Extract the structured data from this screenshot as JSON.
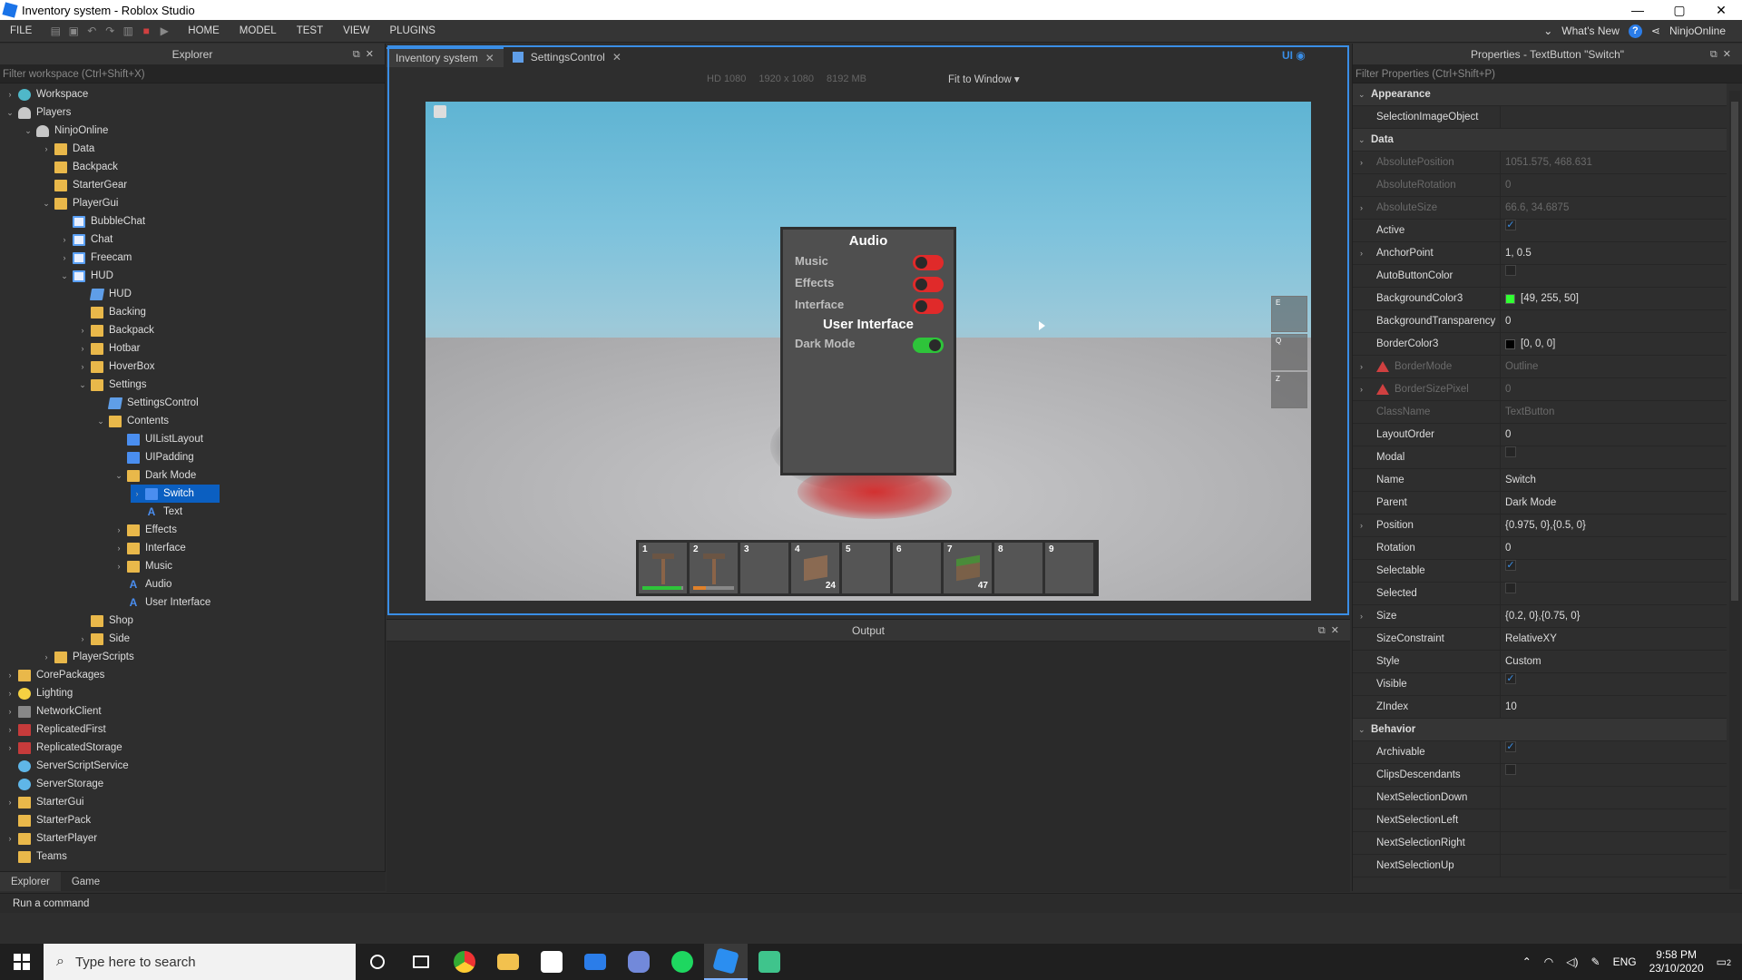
{
  "window": {
    "title": "Inventory system - Roblox Studio",
    "min": "—",
    "max": "▢",
    "close": "✕"
  },
  "menu": {
    "items": [
      "FILE",
      "HOME",
      "MODEL",
      "TEST",
      "VIEW",
      "PLUGINS"
    ],
    "whats_new": "What's New",
    "user": "NinjoOnline"
  },
  "explorer": {
    "title": "Explorer",
    "filter_placeholder": "Filter workspace (Ctrl+Shift+X)",
    "tabs": [
      "Explorer",
      "Game"
    ],
    "rows": [
      {
        "label": "Workspace",
        "level": 0,
        "arrow": "›",
        "icon": "world"
      },
      {
        "label": "Players",
        "level": 0,
        "arrow": "⌄",
        "icon": "player"
      },
      {
        "label": "NinjoOnline",
        "level": 1,
        "arrow": "⌄",
        "icon": "player"
      },
      {
        "label": "Data",
        "level": 2,
        "arrow": "›",
        "icon": "fold"
      },
      {
        "label": "Backpack",
        "level": 2,
        "arrow": "",
        "icon": "fold"
      },
      {
        "label": "StarterGear",
        "level": 2,
        "arrow": "",
        "icon": "fold"
      },
      {
        "label": "PlayerGui",
        "level": 2,
        "arrow": "⌄",
        "icon": "fold"
      },
      {
        "label": "BubbleChat",
        "level": 3,
        "arrow": "",
        "icon": "gui"
      },
      {
        "label": "Chat",
        "level": 3,
        "arrow": "›",
        "icon": "gui"
      },
      {
        "label": "Freecam",
        "level": 3,
        "arrow": "›",
        "icon": "gui"
      },
      {
        "label": "HUD",
        "level": 3,
        "arrow": "⌄",
        "icon": "gui"
      },
      {
        "label": "HUD",
        "level": 4,
        "arrow": "",
        "icon": "script"
      },
      {
        "label": "Backing",
        "level": 4,
        "arrow": "",
        "icon": "fold"
      },
      {
        "label": "Backpack",
        "level": 4,
        "arrow": "›",
        "icon": "fold"
      },
      {
        "label": "Hotbar",
        "level": 4,
        "arrow": "›",
        "icon": "fold"
      },
      {
        "label": "HoverBox",
        "level": 4,
        "arrow": "›",
        "icon": "fold"
      },
      {
        "label": "Settings",
        "level": 4,
        "arrow": "⌄",
        "icon": "fold"
      },
      {
        "label": "SettingsControl",
        "level": 5,
        "arrow": "",
        "icon": "script"
      },
      {
        "label": "Contents",
        "level": 5,
        "arrow": "⌄",
        "icon": "fold"
      },
      {
        "label": "UIListLayout",
        "level": 6,
        "arrow": "",
        "icon": "blue"
      },
      {
        "label": "UIPadding",
        "level": 6,
        "arrow": "",
        "icon": "blue"
      },
      {
        "label": "Dark Mode",
        "level": 6,
        "arrow": "⌄",
        "icon": "fold"
      },
      {
        "label": "Switch",
        "level": 7,
        "arrow": "›",
        "icon": "blue",
        "selected": true
      },
      {
        "label": "Text",
        "level": 7,
        "arrow": "",
        "icon": "text"
      },
      {
        "label": "Effects",
        "level": 6,
        "arrow": "›",
        "icon": "fold"
      },
      {
        "label": "Interface",
        "level": 6,
        "arrow": "›",
        "icon": "fold"
      },
      {
        "label": "Music",
        "level": 6,
        "arrow": "›",
        "icon": "fold"
      },
      {
        "label": "Audio",
        "level": 6,
        "arrow": "",
        "icon": "text"
      },
      {
        "label": "User Interface",
        "level": 6,
        "arrow": "",
        "icon": "text"
      },
      {
        "label": "Shop",
        "level": 4,
        "arrow": "",
        "icon": "fold"
      },
      {
        "label": "Side",
        "level": 4,
        "arrow": "›",
        "icon": "fold"
      },
      {
        "label": "PlayerScripts",
        "level": 2,
        "arrow": "›",
        "icon": "fold"
      },
      {
        "label": "CorePackages",
        "level": 0,
        "arrow": "›",
        "icon": "fold"
      },
      {
        "label": "Lighting",
        "level": 0,
        "arrow": "›",
        "icon": "bulb"
      },
      {
        "label": "NetworkClient",
        "level": 0,
        "arrow": "›",
        "icon": "net"
      },
      {
        "label": "ReplicatedFirst",
        "level": 0,
        "arrow": "›",
        "icon": "red"
      },
      {
        "label": "ReplicatedStorage",
        "level": 0,
        "arrow": "›",
        "icon": "red"
      },
      {
        "label": "ServerScriptService",
        "level": 0,
        "arrow": "",
        "icon": "gear"
      },
      {
        "label": "ServerStorage",
        "level": 0,
        "arrow": "",
        "icon": "gear"
      },
      {
        "label": "StarterGui",
        "level": 0,
        "arrow": "›",
        "icon": "fold"
      },
      {
        "label": "StarterPack",
        "level": 0,
        "arrow": "",
        "icon": "fold"
      },
      {
        "label": "StarterPlayer",
        "level": 0,
        "arrow": "›",
        "icon": "fold"
      },
      {
        "label": "Teams",
        "level": 0,
        "arrow": "",
        "icon": "fold"
      }
    ]
  },
  "doc_tabs": [
    {
      "label": "Inventory system",
      "active": true
    },
    {
      "label": "SettingsControl",
      "active": false
    }
  ],
  "viewport": {
    "device": "HD 1080",
    "resolution": "1920 x 1080",
    "memory": "8192 MB",
    "fit": "Fit to Window ▾",
    "ui_label": "UI",
    "settings": {
      "audio_title": "Audio",
      "ui_title": "User Interface",
      "toggles": [
        {
          "label": "Music",
          "on": false
        },
        {
          "label": "Effects",
          "on": false
        },
        {
          "label": "Interface",
          "on": false
        },
        {
          "label": "Dark Mode",
          "on": true
        }
      ]
    },
    "side_slots": [
      "E",
      "Q",
      "Z"
    ],
    "hotbar": [
      {
        "num": "1",
        "item": "tool",
        "bar": 0.95,
        "bar_color": "#2ec43a"
      },
      {
        "num": "2",
        "item": "tool",
        "bar": 0.3,
        "bar_color": "#e0812a"
      },
      {
        "num": "3"
      },
      {
        "num": "4",
        "item": "cube",
        "count": "24"
      },
      {
        "num": "5"
      },
      {
        "num": "6"
      },
      {
        "num": "7",
        "item": "grass",
        "count": "47"
      },
      {
        "num": "8"
      },
      {
        "num": "9"
      }
    ]
  },
  "output": {
    "title": "Output"
  },
  "properties": {
    "title": "Properties - TextButton \"Switch\"",
    "filter_placeholder": "Filter Properties (Ctrl+Shift+P)",
    "rows": [
      {
        "type": "cat",
        "name": "Appearance"
      },
      {
        "name": "SelectionImageObject",
        "value": ""
      },
      {
        "type": "cat",
        "name": "Data"
      },
      {
        "name": "AbsolutePosition",
        "value": "1051.575, 468.631",
        "arrow": true,
        "disabled": true
      },
      {
        "name": "AbsoluteRotation",
        "value": "0",
        "disabled": true
      },
      {
        "name": "AbsoluteSize",
        "value": "66.6, 34.6875",
        "arrow": true,
        "disabled": true
      },
      {
        "name": "Active",
        "check": true
      },
      {
        "name": "AnchorPoint",
        "value": "1, 0.5",
        "arrow": true
      },
      {
        "name": "AutoButtonColor",
        "check": false
      },
      {
        "name": "BackgroundColor3",
        "value": "[49, 255, 50]",
        "swatch": "#31ff32"
      },
      {
        "name": "BackgroundTransparency",
        "value": "0"
      },
      {
        "name": "BorderColor3",
        "value": "[0, 0, 0]",
        "swatch": "#000000"
      },
      {
        "name": "BorderMode",
        "value": "Outline",
        "arrow": true,
        "disabled": true,
        "warn": true
      },
      {
        "name": "BorderSizePixel",
        "value": "0",
        "arrow": true,
        "disabled": true,
        "warn": true
      },
      {
        "name": "ClassName",
        "value": "TextButton",
        "disabled": true
      },
      {
        "name": "LayoutOrder",
        "value": "0"
      },
      {
        "name": "Modal",
        "check": false
      },
      {
        "name": "Name",
        "value": "Switch"
      },
      {
        "name": "Parent",
        "value": "Dark Mode"
      },
      {
        "name": "Position",
        "value": "{0.975, 0},{0.5, 0}",
        "arrow": true
      },
      {
        "name": "Rotation",
        "value": "0"
      },
      {
        "name": "Selectable",
        "check": true
      },
      {
        "name": "Selected",
        "check": false
      },
      {
        "name": "Size",
        "value": "{0.2, 0},{0.75, 0}",
        "arrow": true
      },
      {
        "name": "SizeConstraint",
        "value": "RelativeXY"
      },
      {
        "name": "Style",
        "value": "Custom"
      },
      {
        "name": "Visible",
        "check": true
      },
      {
        "name": "ZIndex",
        "value": "10"
      },
      {
        "type": "cat",
        "name": "Behavior"
      },
      {
        "name": "Archivable",
        "check": true
      },
      {
        "name": "ClipsDescendants",
        "check": false
      },
      {
        "name": "NextSelectionDown",
        "value": ""
      },
      {
        "name": "NextSelectionLeft",
        "value": ""
      },
      {
        "name": "NextSelectionRight",
        "value": ""
      },
      {
        "name": "NextSelectionUp",
        "value": ""
      }
    ]
  },
  "command_bar": {
    "placeholder": "Run a command"
  },
  "taskbar": {
    "search_placeholder": "Type here to search",
    "lang": "ENG",
    "time": "9:58 PM",
    "date": "23/10/2020",
    "notif": "2"
  }
}
